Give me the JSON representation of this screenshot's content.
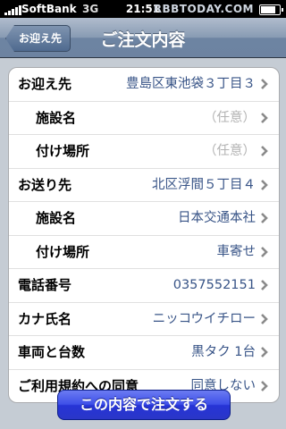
{
  "status_bar": {
    "carrier": "SoftBank",
    "network": "3G",
    "time": "21:51",
    "watermark": "RBBTODAY.COM"
  },
  "nav": {
    "back_label": "お迎え先",
    "title": "ご注文内容"
  },
  "rows": [
    {
      "label": "お迎え先",
      "value": "豊島区東池袋３丁目３",
      "placeholder": false,
      "sub": false
    },
    {
      "label": "施設名",
      "value": "（任意）",
      "placeholder": true,
      "sub": true
    },
    {
      "label": "付け場所",
      "value": "（任意）",
      "placeholder": true,
      "sub": true
    },
    {
      "label": "お送り先",
      "value": "北区浮間５丁目４",
      "placeholder": false,
      "sub": false
    },
    {
      "label": "施設名",
      "value": "日本交通本社",
      "placeholder": false,
      "sub": true
    },
    {
      "label": "付け場所",
      "value": "車寄せ",
      "placeholder": false,
      "sub": true
    },
    {
      "label": "電話番号",
      "value": "0357552151",
      "placeholder": false,
      "sub": false
    },
    {
      "label": "カナ氏名",
      "value": "ニッコウイチロー",
      "placeholder": false,
      "sub": false
    },
    {
      "label": "車両と台数",
      "value": "黒タク 1台",
      "placeholder": false,
      "sub": false
    },
    {
      "label": "ご利用規約への同意",
      "value": "同意しない",
      "placeholder": false,
      "sub": false
    }
  ],
  "order_button": "この内容で注文する",
  "colors": {
    "value_text": "#385487",
    "placeholder_text": "#b3b3b3",
    "button": "#3d4fe8"
  }
}
